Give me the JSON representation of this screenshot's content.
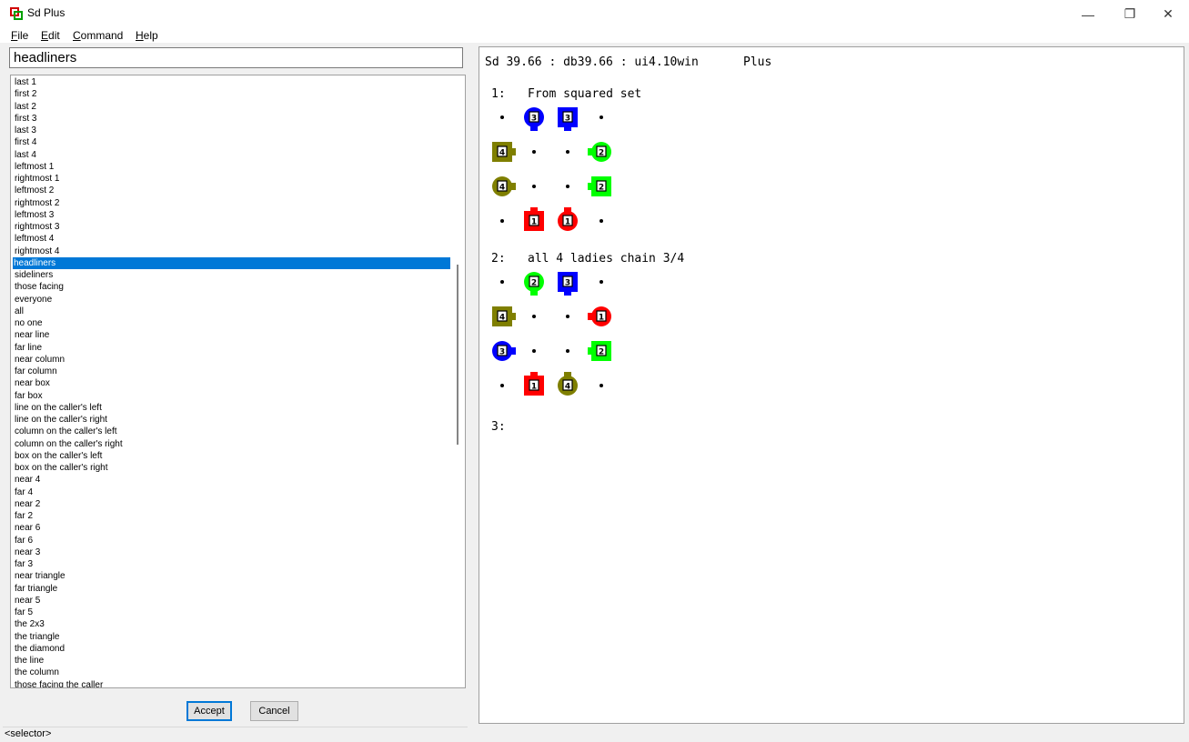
{
  "window": {
    "title": "Sd Plus",
    "minimize_glyph": "—",
    "restore_glyph": "❐",
    "close_glyph": "✕"
  },
  "menu": {
    "items": [
      "File",
      "Edit",
      "Command",
      "Help"
    ]
  },
  "search": {
    "value": "headliners"
  },
  "list": {
    "selected_index": 15,
    "items": [
      "last 1",
      "first 2",
      "last 2",
      "first 3",
      "last 3",
      "first 4",
      "last 4",
      "leftmost 1",
      "rightmost 1",
      "leftmost 2",
      "rightmost 2",
      "leftmost 3",
      "rightmost 3",
      "leftmost 4",
      "rightmost 4",
      "headliners",
      "sideliners",
      "those facing",
      "everyone",
      "all",
      "no one",
      "near line",
      "far line",
      "near column",
      "far column",
      "near box",
      "far box",
      "line on the caller's left",
      "line on the caller's right",
      "column on the caller's left",
      "column on the caller's right",
      "box on the caller's left",
      "box on the caller's right",
      "near 4",
      "far 4",
      "near 2",
      "far 2",
      "near 6",
      "far 6",
      "near 3",
      "far 3",
      "near triangle",
      "far triangle",
      "near 5",
      "far 5",
      "the 2x3",
      "the triangle",
      "the diamond",
      "the line",
      "the column",
      "those facing the caller"
    ]
  },
  "buttons": {
    "accept": "Accept",
    "cancel": "Cancel"
  },
  "status": {
    "text": "<selector>"
  },
  "output": {
    "header": "Sd 39.66 : db39.66 : ui4.10win",
    "level": "Plus",
    "steps": [
      {
        "label": "1:",
        "text": "From squared set",
        "dancers": [
          {
            "couple": "3",
            "sex": "girl",
            "facing": "down",
            "row": 0,
            "col": 1
          },
          {
            "couple": "3",
            "sex": "boy",
            "facing": "down",
            "row": 0,
            "col": 2
          },
          {
            "couple": "4",
            "sex": "boy",
            "facing": "right",
            "row": 1,
            "col": 0
          },
          {
            "couple": "2",
            "sex": "girl",
            "facing": "left",
            "row": 1,
            "col": 3
          },
          {
            "couple": "4",
            "sex": "girl",
            "facing": "right",
            "row": 2,
            "col": 0
          },
          {
            "couple": "2",
            "sex": "boy",
            "facing": "left",
            "row": 2,
            "col": 3
          },
          {
            "couple": "1",
            "sex": "boy",
            "facing": "up",
            "row": 3,
            "col": 1
          },
          {
            "couple": "1",
            "sex": "girl",
            "facing": "up",
            "row": 3,
            "col": 2
          }
        ],
        "dots": [
          {
            "row": 0,
            "col": 0
          },
          {
            "row": 0,
            "col": 3
          },
          {
            "row": 1,
            "col": 1
          },
          {
            "row": 1,
            "col": 2
          },
          {
            "row": 2,
            "col": 1
          },
          {
            "row": 2,
            "col": 2
          },
          {
            "row": 3,
            "col": 0
          },
          {
            "row": 3,
            "col": 3
          }
        ]
      },
      {
        "label": "2:",
        "text": "all 4 ladies chain 3/4",
        "dancers": [
          {
            "couple": "2",
            "sex": "girl",
            "facing": "down",
            "row": 0,
            "col": 1
          },
          {
            "couple": "3",
            "sex": "boy",
            "facing": "down",
            "row": 0,
            "col": 2
          },
          {
            "couple": "4",
            "sex": "boy",
            "facing": "right",
            "row": 1,
            "col": 0
          },
          {
            "couple": "1",
            "sex": "girl",
            "facing": "left",
            "row": 1,
            "col": 3
          },
          {
            "couple": "3",
            "sex": "girl",
            "facing": "right",
            "row": 2,
            "col": 0
          },
          {
            "couple": "2",
            "sex": "boy",
            "facing": "left",
            "row": 2,
            "col": 3
          },
          {
            "couple": "1",
            "sex": "boy",
            "facing": "up",
            "row": 3,
            "col": 1
          },
          {
            "couple": "4",
            "sex": "girl",
            "facing": "up",
            "row": 3,
            "col": 2
          }
        ],
        "dots": [
          {
            "row": 0,
            "col": 0
          },
          {
            "row": 0,
            "col": 3
          },
          {
            "row": 1,
            "col": 1
          },
          {
            "row": 1,
            "col": 2
          },
          {
            "row": 2,
            "col": 1
          },
          {
            "row": 2,
            "col": 2
          },
          {
            "row": 3,
            "col": 0
          },
          {
            "row": 3,
            "col": 3
          }
        ]
      },
      {
        "label": "3:",
        "text": ""
      }
    ]
  },
  "colors": {
    "1": "#ff0000",
    "2": "#00ff00",
    "3": "#0000ff",
    "4": "#7f7f00",
    "selection": "#0078d7"
  }
}
